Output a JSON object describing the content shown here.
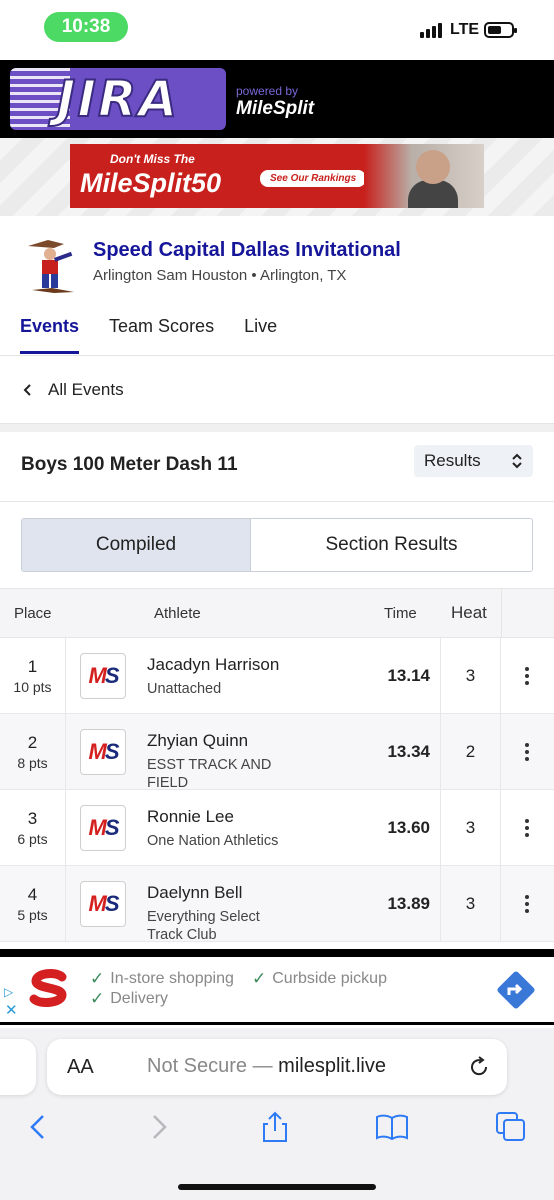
{
  "status_bar": {
    "time": "10:38",
    "network": "LTE"
  },
  "header": {
    "logo_text": "JIRA",
    "powered_by": "powered by",
    "partner": "MileSplit"
  },
  "ad_banner": {
    "line1": "Don't Miss The",
    "line2": "MileSplit50",
    "cta": "See Our Rankings"
  },
  "meet": {
    "title": "Speed Capital Dallas Invitational",
    "subtitle": "Arlington Sam Houston • Arlington, TX",
    "tabs": [
      {
        "label": "Events",
        "active": true
      },
      {
        "label": "Team Scores",
        "active": false
      },
      {
        "label": "Live",
        "active": false
      }
    ]
  },
  "nav": {
    "back_label": "All Events"
  },
  "event": {
    "title": "Boys 100 Meter Dash 11",
    "view_select": "Results",
    "segments": [
      {
        "label": "Compiled",
        "active": true
      },
      {
        "label": "Section Results",
        "active": false
      }
    ]
  },
  "table": {
    "columns": {
      "place": "Place",
      "athlete": "Athlete",
      "time": "Time",
      "heat": "Heat"
    },
    "rows": [
      {
        "place": "1",
        "pts": "10 pts",
        "name": "Jacadyn Harrison",
        "team": "Unattached",
        "time": "13.14",
        "heat": "3"
      },
      {
        "place": "2",
        "pts": "8 pts",
        "name": "Zhyian Quinn",
        "team": "ESST TRACK AND FIELD",
        "time": "13.34",
        "heat": "2"
      },
      {
        "place": "3",
        "pts": "6 pts",
        "name": "Ronnie Lee",
        "team": "One Nation Athletics",
        "time": "13.60",
        "heat": "3"
      },
      {
        "place": "4",
        "pts": "5 pts",
        "name": "Daelynn Bell",
        "team": "Everything Select Track Club",
        "time": "13.89",
        "heat": "3"
      }
    ],
    "logo_text": {
      "m": "M",
      "s": "S"
    }
  },
  "bottom_ad": {
    "features": [
      "In-store shopping",
      "Curbside pickup",
      "Delivery"
    ]
  },
  "browser": {
    "text_size_label": "AA",
    "security": "Not Secure —",
    "domain": "milesplit.live"
  },
  "colors": {
    "brand_navy": "#16169a",
    "jira_purple": "#6c4fc4",
    "milesplit_red": "#c8201c",
    "status_green": "#4cd964"
  }
}
